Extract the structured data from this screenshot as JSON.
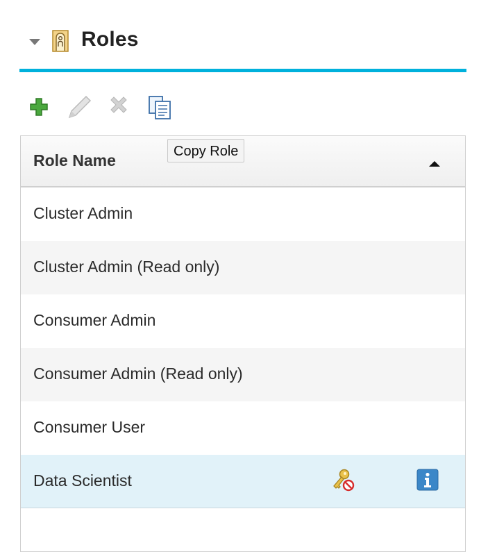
{
  "section": {
    "title": "Roles",
    "icons": {
      "collapse": "caret-down-icon",
      "section": "door-icon"
    }
  },
  "toolbar": {
    "buttons": [
      {
        "name": "add-role-button",
        "icon": "plus-icon",
        "enabled": true
      },
      {
        "name": "edit-role-button",
        "icon": "pencil-icon",
        "enabled": false
      },
      {
        "name": "delete-role-button",
        "icon": "x-delete-icon",
        "enabled": false
      },
      {
        "name": "copy-role-button",
        "icon": "copy-icon",
        "enabled": true
      }
    ],
    "tooltip": "Copy Role"
  },
  "grid": {
    "column_header": "Role Name",
    "sort": "ascending",
    "rows": [
      {
        "label": "Cluster Admin"
      },
      {
        "label": "Cluster Admin (Read only)"
      },
      {
        "label": "Consumer Admin"
      },
      {
        "label": "Consumer Admin (Read only)"
      },
      {
        "label": "Consumer User"
      },
      {
        "label": "Data Scientist",
        "selected": true,
        "icons": [
          "key-no-access-icon",
          "info-icon"
        ]
      }
    ]
  },
  "colors": {
    "accent": "#00b1dc",
    "selected_row": "#e1f2f9",
    "alt_row": "#f5f5f5",
    "add_green": "#3d9b35",
    "info_blue": "#3b87c8"
  }
}
